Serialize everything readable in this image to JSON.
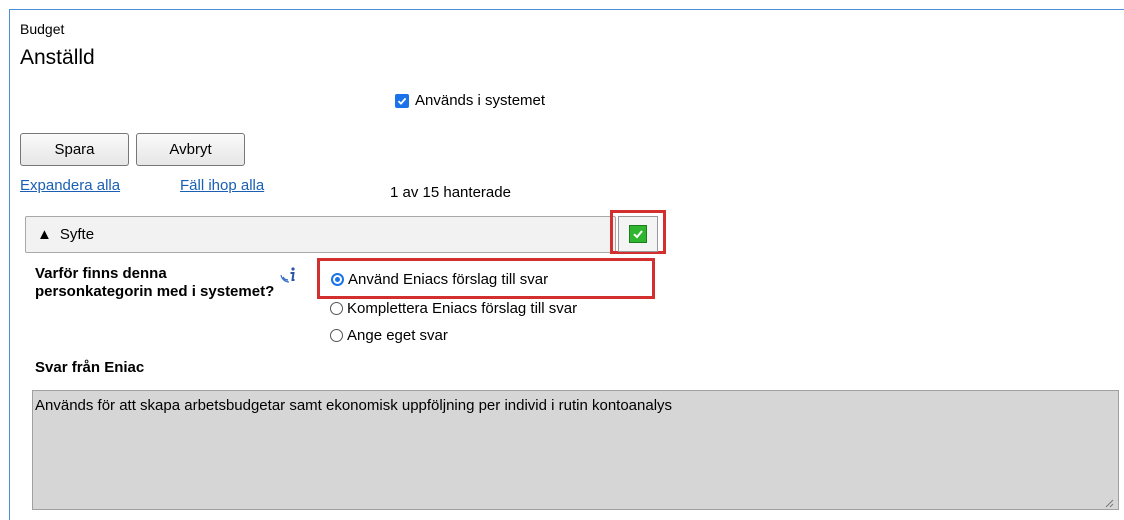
{
  "header": {
    "breadcrumb": "Budget",
    "title": "Anställd"
  },
  "in_system": {
    "label": "Används i systemet",
    "checked": true
  },
  "toolbar": {
    "save_label": "Spara",
    "cancel_label": "Avbryt"
  },
  "links": {
    "expand_all": "Expandera alla",
    "collapse_all": "Fäll ihop alla"
  },
  "progress_text": "1 av 15 hanterade",
  "section": {
    "arrow": "▲",
    "title": "Syfte",
    "status_icon": "green-check-icon"
  },
  "question": {
    "text": "Varför finns denna personkategorin med i systemet?",
    "options": [
      {
        "label": "Använd Eniacs förslag till svar",
        "selected": true
      },
      {
        "label": "Komplettera Eniacs förslag till svar",
        "selected": false
      },
      {
        "label": "Ange eget svar",
        "selected": false
      }
    ]
  },
  "answer": {
    "label": "Svar från Eniac",
    "text": "Används för att skapa arbetsbudgetar samt ekonomisk uppföljning per individ i rutin kontoanalys"
  },
  "colors": {
    "highlight": "#d32f2f",
    "link": "#1a5fb4",
    "accent": "#1a73e8",
    "status_green": "#2fb52f"
  }
}
